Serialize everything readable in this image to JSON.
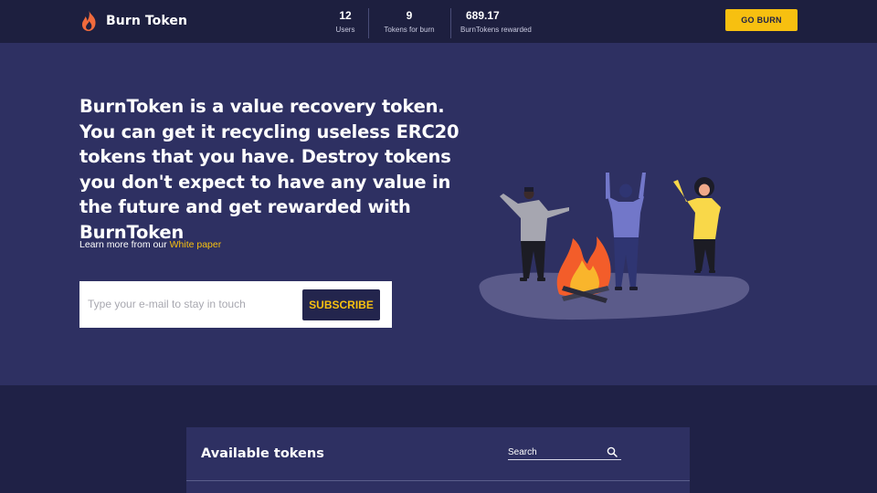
{
  "header": {
    "logo_text": "Burn Token",
    "stats": [
      {
        "value": "12",
        "label": "Users"
      },
      {
        "value": "9",
        "label": "Tokens for burn"
      },
      {
        "value": "689.17",
        "label": "BurnTokens rewarded"
      }
    ],
    "go_burn_label": "GO BURN"
  },
  "hero": {
    "title": "BurnToken is a value recovery token. You can get it recycling useless ERC20 tokens that you have. Destroy tokens you don't expect to have any value in the future and get rewarded with BurnToken",
    "learn_more_prefix": "Learn more from our ",
    "white_paper_link": "White paper",
    "email_placeholder": "Type your e-mail to stay in touch",
    "subscribe_label": "SUBSCRIBE"
  },
  "tokens": {
    "title": "Available tokens",
    "search_label": "Search"
  },
  "colors": {
    "accent": "#f7c010",
    "topbar_bg": "#1d1f3f",
    "hero_bg": "#2e3062",
    "page_bg": "#1f2146"
  }
}
